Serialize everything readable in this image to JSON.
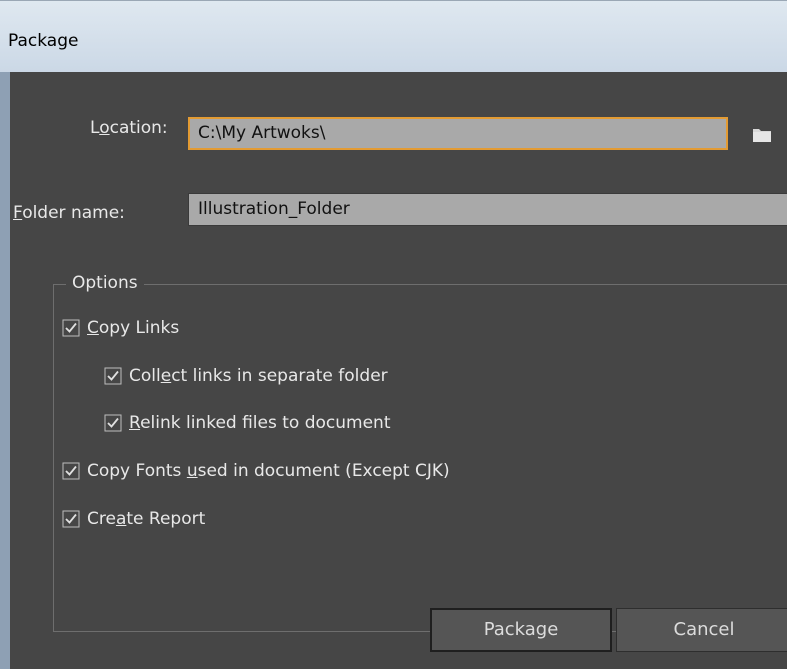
{
  "window": {
    "title": "Package"
  },
  "location": {
    "label_pre": "L",
    "label_u": "o",
    "label_post": "cation:",
    "value": "C:\\My Artwoks\\",
    "browse_icon": "folder-icon"
  },
  "folder_name": {
    "label_pre": "",
    "label_u": "F",
    "label_post": "older name:",
    "value": "Illustration_Folder"
  },
  "options": {
    "legend": "Options",
    "items": [
      {
        "pre": "",
        "u": "C",
        "post": "opy Links",
        "checked": true
      },
      {
        "pre": "Coll",
        "u": "e",
        "post": "ct links in separate folder",
        "checked": true
      },
      {
        "pre": "",
        "u": "R",
        "post": "elink linked files to document",
        "checked": true
      },
      {
        "pre": "Copy Fonts ",
        "u": "u",
        "post": "sed in document (Except CJK)",
        "checked": true
      },
      {
        "pre": "Cre",
        "u": "a",
        "post": "te Report",
        "checked": true
      }
    ]
  },
  "buttons": {
    "package": "Package",
    "cancel": "Cancel"
  },
  "colors": {
    "background": "#464646",
    "field": "#a9a9a9",
    "focus_border": "#e39b33",
    "text": "#e8e8e8"
  }
}
